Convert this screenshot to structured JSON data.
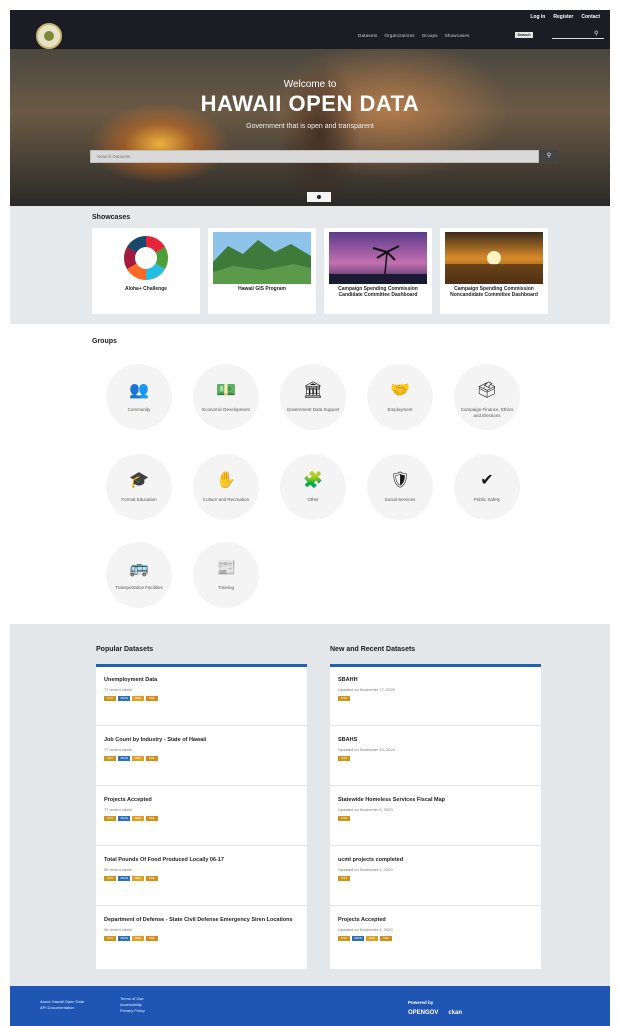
{
  "header": {
    "account_links": [
      "Log in",
      "Register",
      "Contact"
    ],
    "nav_items": [
      "Datasets",
      "Organizations",
      "Groups",
      "Showcases"
    ],
    "search_button": "Search"
  },
  "hero": {
    "welcome": "Welcome to",
    "title": "HAWAII OPEN DATA",
    "subtitle": "Government that is open and transparent",
    "search_placeholder": "Search Datasets"
  },
  "showcases": {
    "title": "Showcases",
    "items": [
      "Aloha+ Challenge",
      "Hawaii GIS Program",
      "Campaign Spending Commission Candidate Committee Dashboard",
      "Campaign Spending Commission Noncandidate Committee Dashboard"
    ]
  },
  "groups": {
    "title": "Groups",
    "items": [
      {
        "label": "Community",
        "icon": "people-icon"
      },
      {
        "label": "Economic Development",
        "icon": "money-icon"
      },
      {
        "label": "Government Data Support",
        "icon": "bank-icon"
      },
      {
        "label": "Employment",
        "icon": "handshake-icon"
      },
      {
        "label": "Campaign Finance, Ethics and Elections",
        "icon": "voter-icon"
      },
      {
        "label": "Formal Education",
        "icon": "graduation-cap-icon"
      },
      {
        "label": "Culture and Recreation",
        "icon": "hands-icon"
      },
      {
        "label": "Other",
        "icon": "puzzle-icon"
      },
      {
        "label": "Social Services",
        "icon": "shield-icon"
      },
      {
        "label": "Public Safety",
        "icon": "badge-icon"
      },
      {
        "label": "Transportation Facilities",
        "icon": "bus-icon"
      },
      {
        "label": "Training",
        "icon": "newspaper-icon"
      }
    ]
  },
  "popular": {
    "title": "Popular Datasets",
    "items": [
      {
        "title": "Unemployment Data",
        "meta": "77 recent views",
        "badges": [
          "CSV",
          "JSON",
          "RDF",
          "XML"
        ]
      },
      {
        "title": "Job Count by Industry - State of Hawaii",
        "meta": "77 recent views",
        "badges": [
          "CSV",
          "JSON",
          "RDF",
          "XML"
        ]
      },
      {
        "title": "Projects Accepted",
        "meta": "77 recent views",
        "badges": [
          "CSV",
          "JSON",
          "RDF",
          "XML"
        ]
      },
      {
        "title": "Total Pounds Of Food Produced Locally 06-17",
        "meta": "56 recent views",
        "badges": [
          "CSV",
          "JSON",
          "RDF",
          "XML"
        ]
      },
      {
        "title": "Department of Defense - State Civil Defense Emergency Siren Locations",
        "meta": "56 recent views",
        "badges": [
          "CSV",
          "JSON",
          "RDF",
          "XML"
        ]
      }
    ]
  },
  "recent": {
    "title": "New and Recent Datasets",
    "items": [
      {
        "title": "SBAHH",
        "meta": "Updated on November 17, 2020",
        "badges": [
          "CSV"
        ]
      },
      {
        "title": "SBAHS",
        "meta": "Updated on November 10, 2020",
        "badges": [
          "CSV"
        ]
      },
      {
        "title": "Statewide Homeless Services Fiscal Map",
        "meta": "Updated on November 6, 2020",
        "badges": [
          "CSV"
        ]
      },
      {
        "title": "ucmt projects completed",
        "meta": "Updated on November 4, 2020",
        "badges": [
          "CSV"
        ]
      },
      {
        "title": "Projects Accepted",
        "meta": "Updated on November 4, 2020",
        "badges": [
          "CSV",
          "JSON",
          "RDF",
          "XML"
        ]
      }
    ]
  },
  "footer": {
    "col1": [
      "About Hawaii Open Data",
      "API Documentation"
    ],
    "col2": [
      "Terms of Use",
      "Accessibility",
      "Privacy Policy"
    ],
    "powered_by": "Powered by",
    "logos": [
      "OPENGOV",
      "ckan"
    ]
  }
}
